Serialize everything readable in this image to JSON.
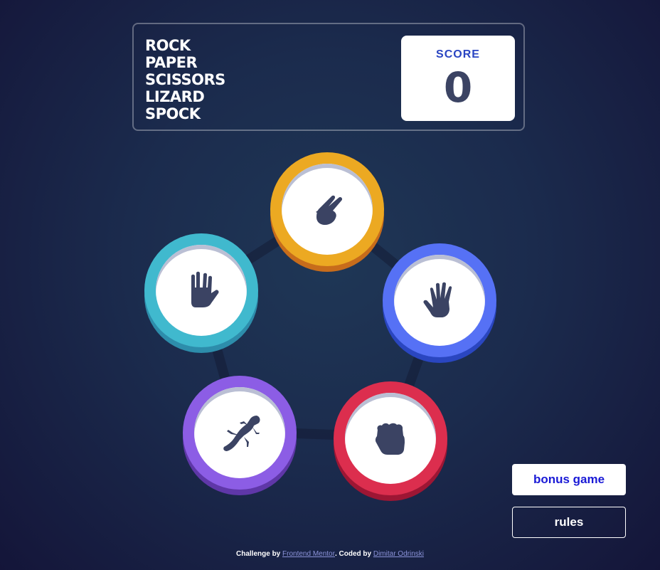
{
  "header": {
    "logo_lines": [
      "ROCK",
      "PAPER",
      "SCISSORS",
      "LIZARD",
      "SPOCK"
    ],
    "score_label": "SCORE",
    "score_value": "0"
  },
  "tokens": [
    {
      "id": "scissors",
      "color": "#eca922",
      "icon": "scissors-icon"
    },
    {
      "id": "spock",
      "color": "#40b9ce",
      "icon": "spock-icon"
    },
    {
      "id": "paper",
      "color": "#5671f5",
      "icon": "paper-icon"
    },
    {
      "id": "lizard",
      "color": "#8c5de5",
      "icon": "lizard-icon"
    },
    {
      "id": "rock",
      "color": "#dc2e4e",
      "icon": "rock-icon"
    }
  ],
  "buttons": {
    "bonus_label": "bonus game",
    "rules_label": "rules"
  },
  "footer": {
    "prefix": "Challenge by ",
    "link1": "Frontend Mentor",
    "middle": ". Coded by ",
    "link2": "Dimitar Odrinski"
  },
  "colors": {
    "icon": "#3b4363",
    "score_label": "#2a45c2",
    "bonus_text": "#1a1ad6"
  }
}
